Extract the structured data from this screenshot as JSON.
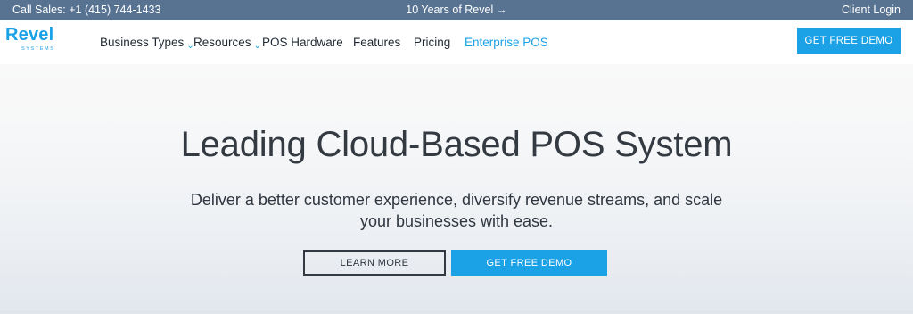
{
  "topbar": {
    "call_sales": "Call Sales: +1 (415) 744-1433",
    "anniversary": "10 Years of Revel",
    "anniversary_arrow": "→",
    "client_login": "Client Login"
  },
  "logo": {
    "word": "Revel",
    "sub": "SYSTEMS"
  },
  "nav": {
    "items": [
      {
        "label": "Business Types",
        "chevron": "⌄"
      },
      {
        "label": "Resources",
        "chevron": "⌄"
      },
      {
        "label": "POS Hardware"
      },
      {
        "label": "Features"
      },
      {
        "label": "Pricing"
      },
      {
        "label": "Enterprise POS"
      }
    ],
    "cta": "GET FREE DEMO"
  },
  "hero": {
    "title": "Leading Cloud-Based POS System",
    "subtitle": "Deliver a better customer experience, diversify revenue streams, and scale your businesses with ease.",
    "learn_more": "LEARN MORE",
    "demo": "GET FREE DEMO"
  },
  "colors": {
    "accent": "#1aa1e6",
    "topbar": "#587391",
    "text": "#2f3640"
  }
}
